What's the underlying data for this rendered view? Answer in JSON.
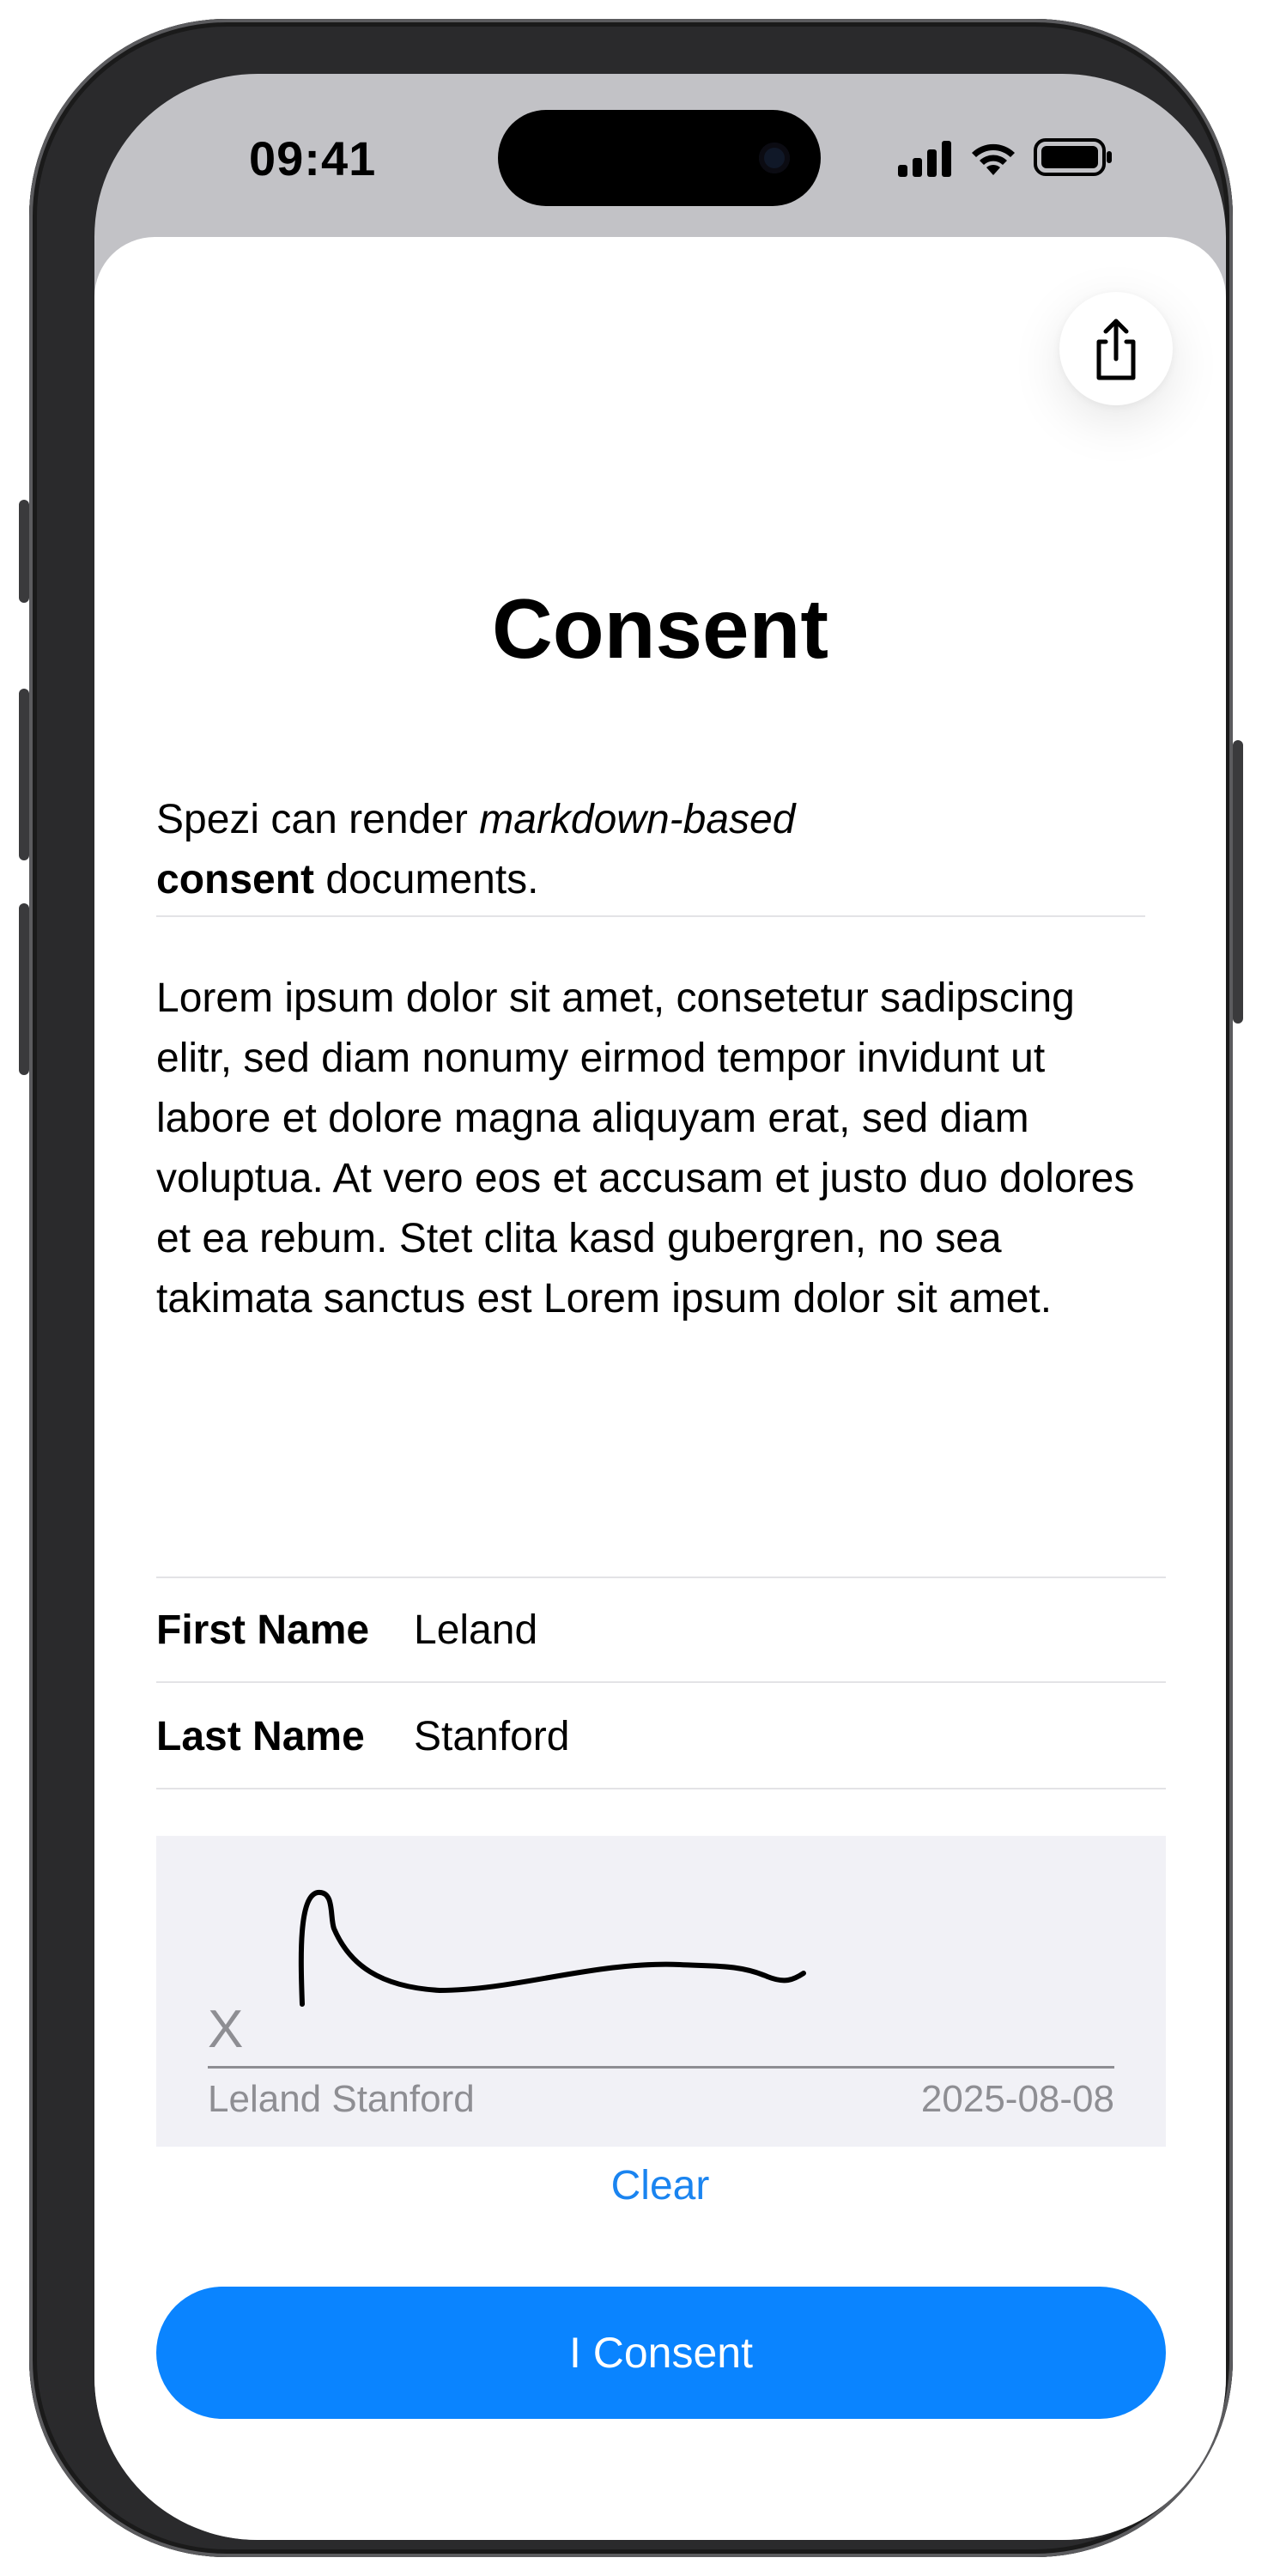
{
  "status_bar": {
    "time": "09:41"
  },
  "document": {
    "title": "Consent",
    "intro": {
      "part1": "Spezi can render ",
      "italic": "markdown-based",
      "bold": "consent",
      "part2": " documents."
    },
    "body": "Lorem ipsum dolor sit amet, consetetur sadipscing elitr, sed diam nonumy eirmod tempor invidunt ut labore et dolore magna aliquyam erat, sed diam voluptua. At vero eos et accusam et justo duo dolores et ea rebum. Stet clita kasd gubergren, no sea takimata sanctus est Lorem ipsum dolor sit amet."
  },
  "form": {
    "first_name": {
      "label": "First Name",
      "value": "Leland"
    },
    "last_name": {
      "label": "Last Name",
      "value": "Stanford"
    }
  },
  "signature": {
    "marker": "X",
    "name": "Leland Stanford",
    "date": "2025-08-08",
    "clear_label": "Clear"
  },
  "actions": {
    "consent_label": "I Consent"
  },
  "icons": {
    "share": "share-icon",
    "signal": "cellular-signal-icon",
    "wifi": "wifi-icon",
    "battery": "battery-icon"
  },
  "colors": {
    "accent": "#0a84ff",
    "link": "#1a84f0",
    "signature_pad": "#f1f1f6",
    "status_bar_bg": "#c2c2c6"
  }
}
